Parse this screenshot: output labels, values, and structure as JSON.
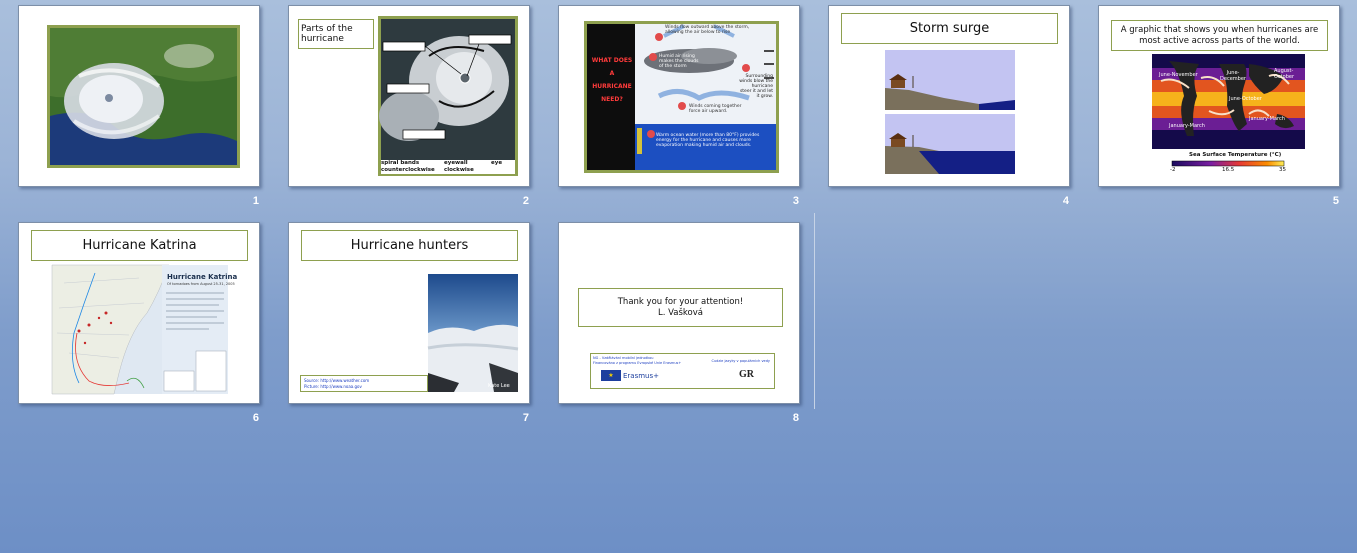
{
  "slides": [
    {
      "number": "1"
    },
    {
      "number": "2",
      "title": "Parts of the hurricane",
      "labels": [
        "spiral bands",
        "eyewall",
        "eye",
        "counterclockwise",
        "clockwise"
      ]
    },
    {
      "number": "3",
      "side_text": "WHAT DOES A HURRICANE NEED?",
      "notes": [
        "Winds flow outward above the storm, allowing the air below to rise",
        "Humid air rising makes the clouds of the storm",
        "Winds coming together force air upward.",
        "Surrounding winds blow the hurricane steer it and let it grow.",
        "Warm ocean water (more than 80°F) provides energy for the hurricane and causes more evaporation making humid air and clouds."
      ],
      "badges": [
        "#1",
        "#2",
        "#3",
        "#4",
        "#5"
      ]
    },
    {
      "number": "4",
      "title": "Storm surge"
    },
    {
      "number": "5",
      "title": "A graphic that shows you when hurricanes are most active across parts of the world.",
      "map_labels": [
        "June-November",
        "June-December",
        "August-October",
        "June-October",
        "January-March",
        "January-March"
      ],
      "colorbar_title": "Sea Surface Temperature (°C)",
      "colorbar_ticks": [
        "-2",
        "16.5",
        "35"
      ]
    },
    {
      "number": "6",
      "title": "Hurricane Katrina",
      "map_title": "Hurricane Katrina",
      "map_subtitle": "Of tornadoes from August 25-31, 2005"
    },
    {
      "number": "7",
      "title": "Hurricane hunters",
      "sources": [
        "Source: http://www.weather.com",
        "Picture: http://www.noaa.gov"
      ],
      "photo_caption": "Kate Lee"
    },
    {
      "number": "8",
      "thanks": "Thank you for your attention!",
      "author": "L. Vašková",
      "footer_line1": "NG - Vzdělávání mobilní jednotkou",
      "footer_line2": "Financováno z programu Evropské Unie Erasmus+",
      "footer_right": "Cudzie jazyky v populárnich vedy",
      "erasmus": "Erasmus+",
      "logo_text": "GR"
    }
  ],
  "colors": {
    "background": "#8faad3",
    "accent_border": "#8ea04f"
  }
}
